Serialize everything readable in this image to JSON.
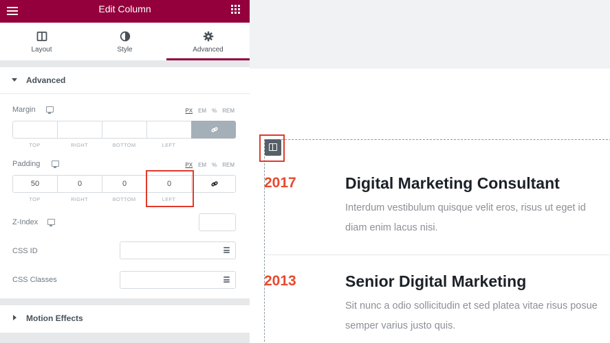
{
  "panel": {
    "title": "Edit Column",
    "tabs": [
      {
        "label": "Layout",
        "icon": "columns-icon"
      },
      {
        "label": "Style",
        "icon": "half-circle-icon"
      },
      {
        "label": "Advanced",
        "icon": "gear-icon",
        "active": true
      }
    ]
  },
  "advanced": {
    "heading": "Advanced",
    "margin": {
      "label": "Margin",
      "units": [
        "PX",
        "EM",
        "%",
        "REM"
      ],
      "active_unit": "PX",
      "values": {
        "top": "",
        "right": "",
        "bottom": "",
        "left": ""
      },
      "side_labels": [
        "TOP",
        "RIGHT",
        "BOTTOM",
        "LEFT"
      ],
      "linked": true
    },
    "padding": {
      "label": "Padding",
      "units": [
        "PX",
        "EM",
        "%",
        "REM"
      ],
      "active_unit": "PX",
      "values": {
        "top": "50",
        "right": "0",
        "bottom": "0",
        "left": "0"
      },
      "side_labels": [
        "TOP",
        "RIGHT",
        "BOTTOM",
        "LEFT"
      ],
      "linked": false
    },
    "z_index": {
      "label": "Z-Index",
      "value": ""
    },
    "css_id": {
      "label": "CSS ID",
      "value": ""
    },
    "css_classes": {
      "label": "CSS Classes",
      "value": ""
    }
  },
  "motion": {
    "heading": "Motion Effects"
  },
  "preview": {
    "entries": [
      {
        "year": "2017",
        "title": "Digital Marketing Consultant",
        "desc_lines": [
          "Interdum vestibulum quisque velit eros, risus ut eget id",
          "diam enim lacus nisi."
        ]
      },
      {
        "year": "2013",
        "title": "Senior Digital Marketing",
        "desc_lines": [
          "Sit nunc a odio sollicitudin et sed platea vitae risus posue",
          "semper varius justo quis."
        ]
      }
    ]
  },
  "colors": {
    "brand": "#93003c",
    "year_accent": "#e8492f",
    "highlight": "#e0392a"
  }
}
